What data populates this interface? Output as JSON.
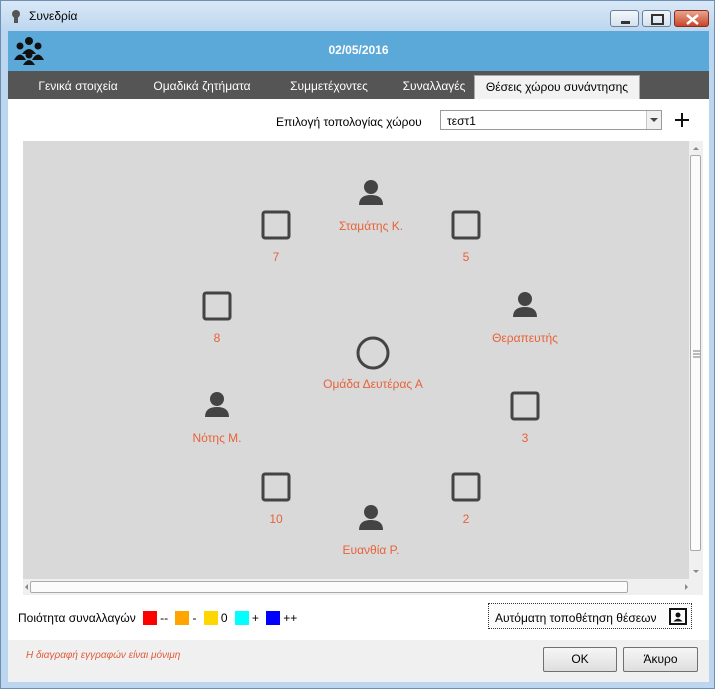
{
  "window": {
    "title": "Συνεδρία"
  },
  "header": {
    "date": "02/05/2016"
  },
  "tabs": [
    {
      "label": "Γενικά στοιχεία"
    },
    {
      "label": "Ομαδικά ζητήματα"
    },
    {
      "label": "Συμμετέχοντες"
    },
    {
      "label": "Συναλλαγές"
    },
    {
      "label": "Θέσεις χώρου συνάντησης",
      "active": true
    }
  ],
  "topology": {
    "label": "Επιλογή τοπολογίας χώρου",
    "selected": "τεστ1"
  },
  "nodes": {
    "stamatis": "Σταμάτης Κ.",
    "seat7": "7",
    "seat5": "5",
    "seat8": "8",
    "therapist": "Θεραπευτής",
    "group": "Ομάδα Δευτέρας Α",
    "notis": "Νότης Μ.",
    "seat3": "3",
    "seat10": "10",
    "seat2": "2",
    "evanthia": "Ευανθία Ρ."
  },
  "legend": {
    "label": "Ποιότητα συναλλαγών",
    "items": [
      {
        "color": "#ff0000",
        "text": "--"
      },
      {
        "color": "#ffa500",
        "text": "-"
      },
      {
        "color": "#ffd700",
        "text": "0"
      },
      {
        "color": "#00ffff",
        "text": "+"
      },
      {
        "color": "#0000ff",
        "text": "++"
      }
    ]
  },
  "auto_button": "Αυτόματη τοποθέτηση θέσεων",
  "warning": "Η διαγραφή εγγραφών είναι μόνιμη",
  "buttons": {
    "ok": "OK",
    "cancel": "Άκυρο"
  },
  "colors": {
    "header": "#5ba9d9",
    "tabbar": "#555555",
    "label": "#e8623a",
    "canvas": "#d9d9d9"
  }
}
